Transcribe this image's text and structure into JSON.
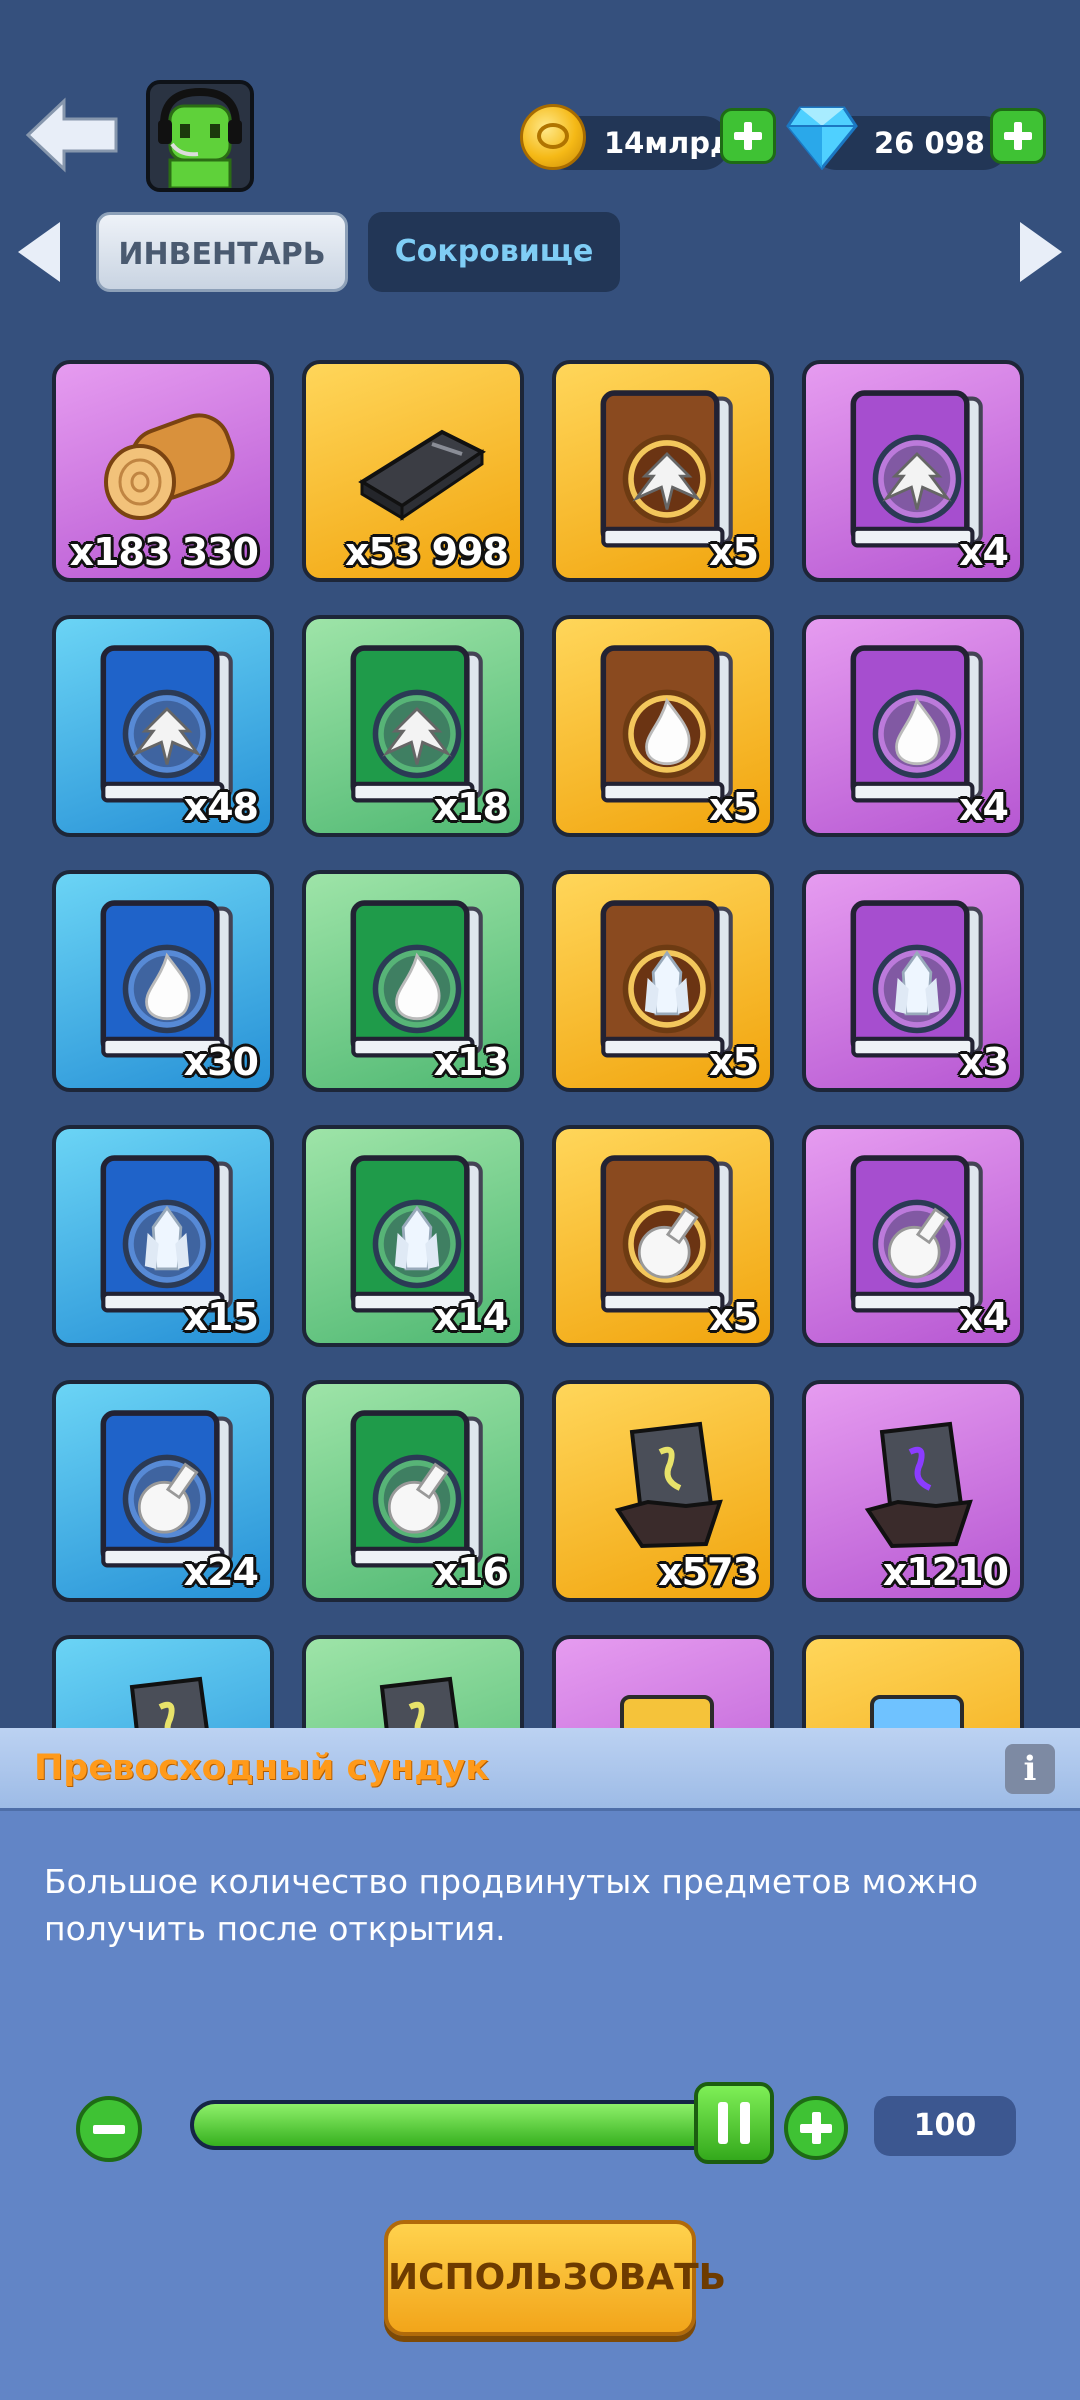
{
  "header": {
    "currency_gold": "14млрд",
    "currency_gems": "26 098"
  },
  "tabs": [
    {
      "label": "ИНВЕНТАРЬ",
      "active": true
    },
    {
      "label": "Сокровище",
      "active": false
    }
  ],
  "colors": {
    "background": "#35507d",
    "purple_rarity": "#c46fdc",
    "gold_rarity": "#f6b624",
    "blue_rarity": "#2f9ddf",
    "green_rarity": "#5bc07a",
    "accent_green": "#3fc234",
    "title_orange": "#ff9a1a"
  },
  "inventory": [
    {
      "icon": "wood-log-icon",
      "rarity": "purple",
      "count": "x183 330"
    },
    {
      "icon": "iron-ingot-icon",
      "rarity": "gold",
      "count": "x53 998"
    },
    {
      "icon": "tree-emblem-book-icon",
      "rarity": "gold",
      "count": "x5"
    },
    {
      "icon": "tree-emblem-book-icon",
      "rarity": "purple",
      "count": "x4"
    },
    {
      "icon": "tree-emblem-book-icon",
      "rarity": "blue",
      "count": "x48"
    },
    {
      "icon": "tree-emblem-book-icon",
      "rarity": "green",
      "count": "x18"
    },
    {
      "icon": "flame-book-icon",
      "rarity": "gold",
      "count": "x5"
    },
    {
      "icon": "flame-book-icon",
      "rarity": "purple",
      "count": "x4"
    },
    {
      "icon": "flame-book-icon",
      "rarity": "blue",
      "count": "x30"
    },
    {
      "icon": "flame-book-icon",
      "rarity": "green",
      "count": "x13"
    },
    {
      "icon": "crystal-book-icon",
      "rarity": "gold",
      "count": "x5"
    },
    {
      "icon": "crystal-book-icon",
      "rarity": "purple",
      "count": "x3"
    },
    {
      "icon": "crystal-book-icon",
      "rarity": "blue",
      "count": "x15"
    },
    {
      "icon": "crystal-book-icon",
      "rarity": "green",
      "count": "x14"
    },
    {
      "icon": "flask-book-icon",
      "rarity": "gold",
      "count": "x5"
    },
    {
      "icon": "flask-book-icon",
      "rarity": "purple",
      "count": "x4"
    },
    {
      "icon": "flask-book-icon",
      "rarity": "blue",
      "count": "x24"
    },
    {
      "icon": "flask-book-icon",
      "rarity": "green",
      "count": "x16"
    },
    {
      "icon": "rune-stone-icon",
      "rarity": "gold",
      "count": "x573"
    },
    {
      "icon": "rune-stone-icon",
      "rarity": "purple",
      "count": "x1210"
    },
    {
      "icon": "rune-stone-icon",
      "rarity": "blue",
      "count": ""
    },
    {
      "icon": "rune-stone-icon",
      "rarity": "green",
      "count": ""
    },
    {
      "icon": "chest-icon",
      "rarity": "purple",
      "count": ""
    },
    {
      "icon": "chest-icon",
      "rarity": "gold",
      "count": ""
    }
  ],
  "panel": {
    "title": "Превосходный сундук",
    "info": "i",
    "description": "Большое количество продвинутых предметов можно получить после открытия.",
    "quantity": "100",
    "slider_level": 1.0,
    "use_button": "ИСПОЛЬЗОВАТЬ"
  }
}
